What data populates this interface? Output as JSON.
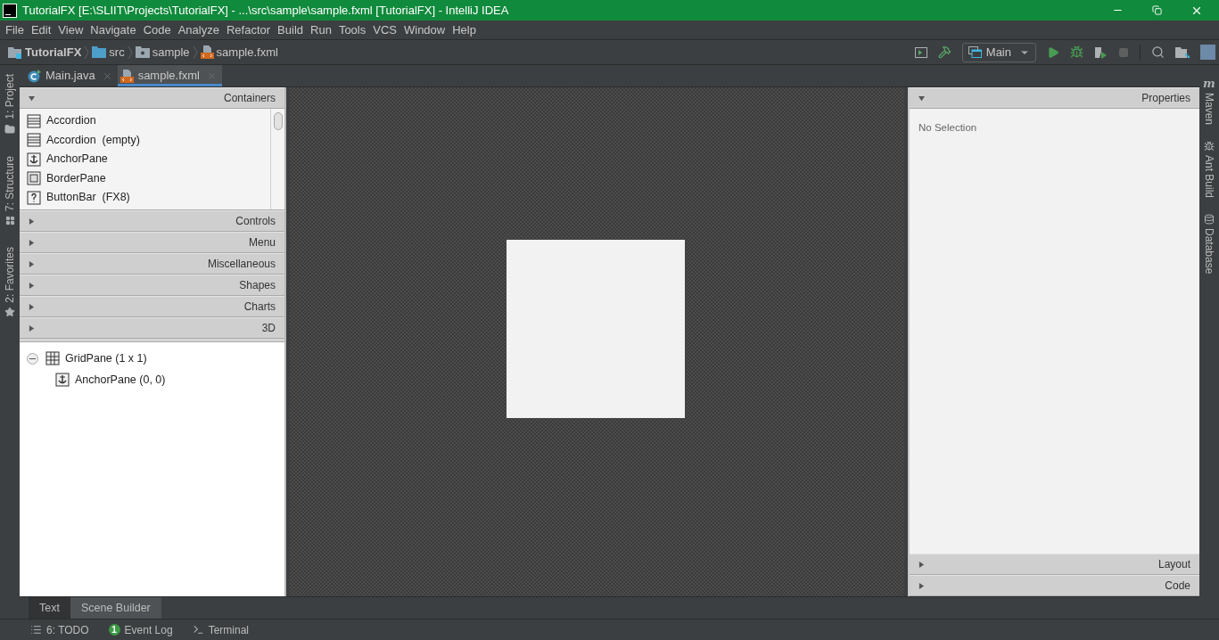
{
  "window": {
    "title": "TutorialFX [E:\\SLIIT\\Projects\\TutorialFX] - ...\\src\\sample\\sample.fxml [TutorialFX] - IntelliJ IDEA"
  },
  "menu": [
    "File",
    "Edit",
    "View",
    "Navigate",
    "Code",
    "Analyze",
    "Refactor",
    "Build",
    "Run",
    "Tools",
    "VCS",
    "Window",
    "Help"
  ],
  "breadcrumbs": [
    {
      "label": "TutorialFX",
      "kind": "project"
    },
    {
      "label": "src",
      "kind": "folder"
    },
    {
      "label": "sample",
      "kind": "package"
    },
    {
      "label": "sample.fxml",
      "kind": "fxml"
    }
  ],
  "run_config": "Main",
  "editor_tabs": [
    {
      "label": "Main.java",
      "kind": "java",
      "selected": false
    },
    {
      "label": "sample.fxml",
      "kind": "fxml",
      "selected": true
    }
  ],
  "left_tools": [
    {
      "label": "1: Project",
      "kind": "folder"
    },
    {
      "label": "7: Structure",
      "kind": "structure"
    },
    {
      "label": "2: Favorites",
      "kind": "star"
    }
  ],
  "right_tools": [
    {
      "label": "Maven",
      "kind": "maven",
      "glyph": "m"
    },
    {
      "label": "Ant Build",
      "kind": "ant"
    },
    {
      "label": "Database",
      "kind": "database"
    }
  ],
  "library": [
    {
      "title": "Containers",
      "expanded": true,
      "items": [
        {
          "label": "Accordion",
          "kind": "accordion"
        },
        {
          "label": "Accordion  (empty)",
          "kind": "accordion"
        },
        {
          "label": "AnchorPane",
          "kind": "anchor"
        },
        {
          "label": "BorderPane",
          "kind": "border"
        },
        {
          "label": "ButtonBar  (FX8)",
          "kind": "unknown"
        }
      ]
    },
    {
      "title": "Controls",
      "expanded": false
    },
    {
      "title": "Menu",
      "expanded": false
    },
    {
      "title": "Miscellaneous",
      "expanded": false
    },
    {
      "title": "Shapes",
      "expanded": false
    },
    {
      "title": "Charts",
      "expanded": false
    },
    {
      "title": "3D",
      "expanded": false
    }
  ],
  "hierarchy": [
    {
      "label": "GridPane (1 x 1)",
      "kind": "grid",
      "expanded": true,
      "children": [
        {
          "label": "AnchorPane (0, 0)",
          "kind": "anchor"
        }
      ]
    }
  ],
  "inspector": [
    {
      "title": "Properties",
      "expanded": true,
      "message": "No Selection"
    },
    {
      "title": "Layout",
      "expanded": false
    },
    {
      "title": "Code",
      "expanded": false
    }
  ],
  "bottom_tabs": [
    {
      "label": "Text",
      "selected": false
    },
    {
      "label": "Scene Builder",
      "selected": true
    }
  ],
  "status_bar": [
    {
      "label": "6: TODO",
      "kind": "todo"
    },
    {
      "label": "Event Log",
      "kind": "log",
      "badge": "1"
    },
    {
      "label": "Terminal",
      "kind": "terminal"
    }
  ]
}
